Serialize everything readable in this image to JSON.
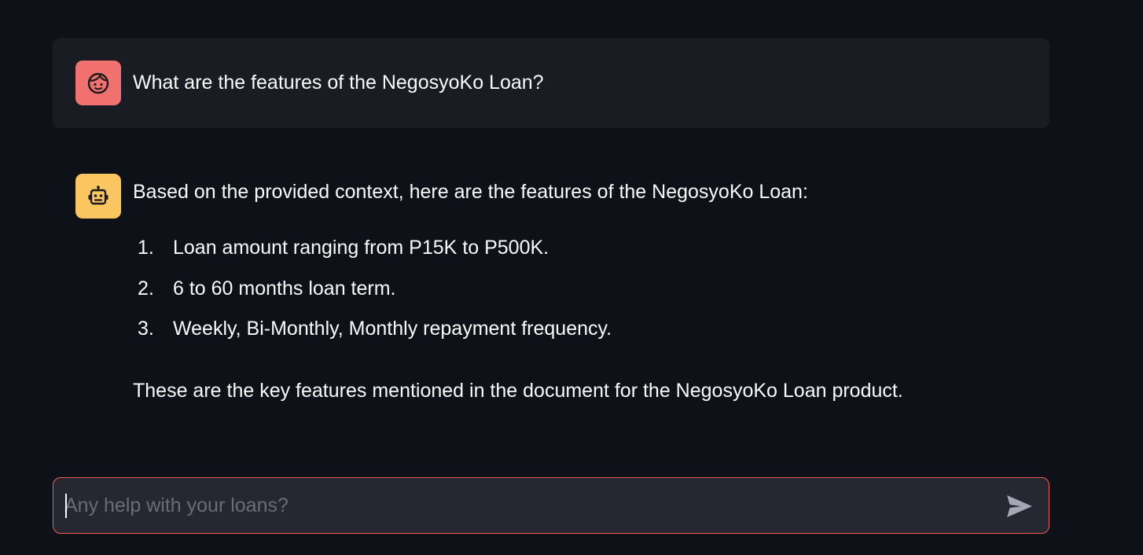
{
  "colors": {
    "background": "#0e1117",
    "user_message_bg": "#1a1c24",
    "user_avatar": "#f0716f",
    "bot_avatar": "#fbc660",
    "input_bg": "#262730",
    "input_border": "#f05a55",
    "text": "#fafafa",
    "placeholder": "#6b6d76"
  },
  "messages": {
    "user": {
      "avatar_icon": "face-icon",
      "text": "What are the features of the NegosyoKo Loan?"
    },
    "assistant": {
      "avatar_icon": "robot-icon",
      "intro": "Based on the provided context, here are the features of the NegosyoKo Loan:",
      "features": [
        {
          "number": "1.",
          "text": "Loan amount ranging from P15K to P500K."
        },
        {
          "number": "2.",
          "text": "6 to 60 months loan term."
        },
        {
          "number": "3.",
          "text": "Weekly, Bi-Monthly, Monthly repayment frequency."
        }
      ],
      "outro": "These are the key features mentioned in the document for the NegosyoKo Loan product."
    }
  },
  "chat_input": {
    "placeholder": "Any help with your loans?",
    "value": "",
    "send_icon": "send-icon"
  }
}
